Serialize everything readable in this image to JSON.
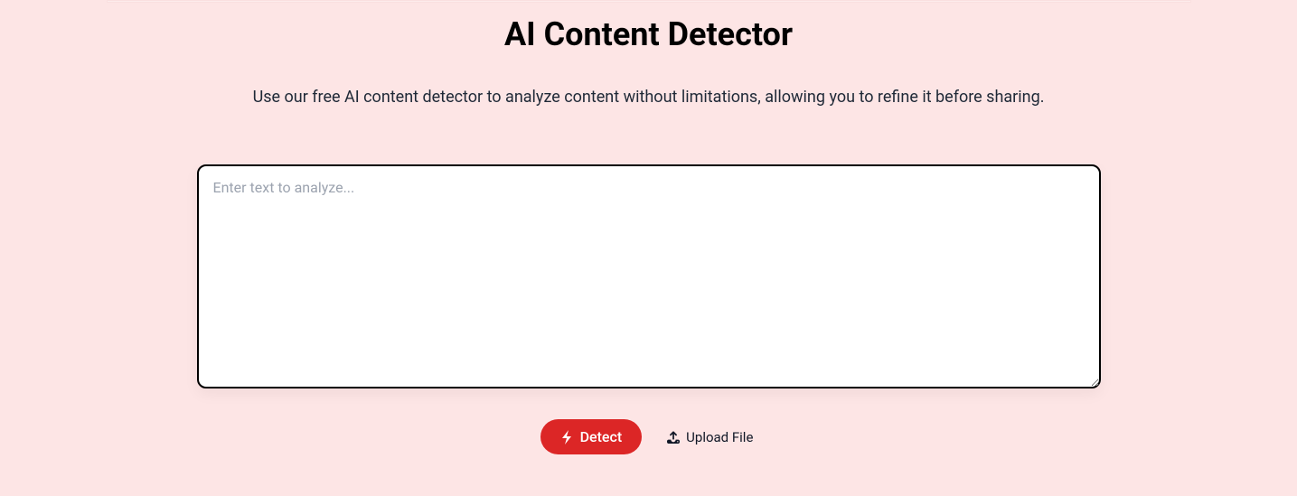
{
  "header": {
    "title": "AI Content Detector",
    "subtitle": "Use our free AI content detector to analyze content without limitations, allowing you to refine it before sharing."
  },
  "input": {
    "placeholder": "Enter text to analyze...",
    "value": ""
  },
  "actions": {
    "detect_label": "Detect",
    "upload_label": "Upload File"
  },
  "colors": {
    "background": "#fde5e5",
    "primary": "#dc2626"
  }
}
